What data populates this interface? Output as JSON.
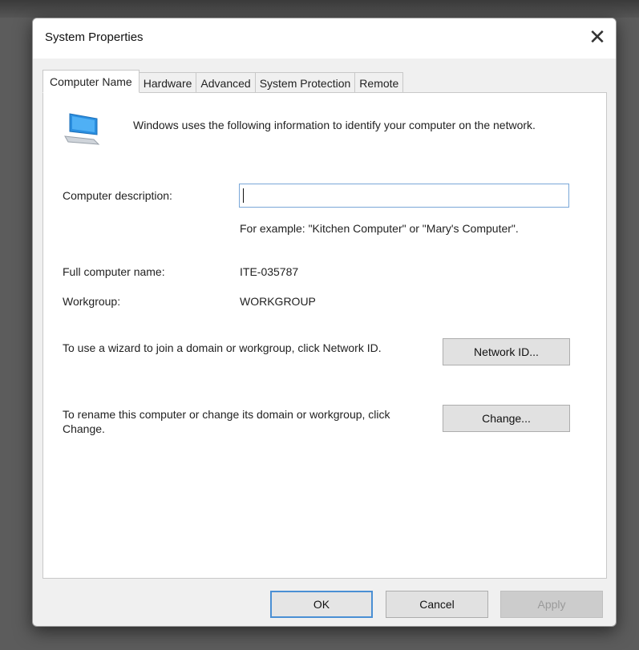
{
  "window": {
    "title": "System Properties",
    "close_glyph": "✕"
  },
  "tabs": [
    {
      "label": "Computer Name",
      "active": true
    },
    {
      "label": "Hardware",
      "active": false
    },
    {
      "label": "Advanced",
      "active": false
    },
    {
      "label": "System Protection",
      "active": false
    },
    {
      "label": "Remote",
      "active": false
    }
  ],
  "panel": {
    "intro": "Windows uses the following information to identify your computer on the network.",
    "description_label": "Computer description:",
    "description_value": "",
    "example": "For example: \"Kitchen Computer\" or \"Mary's Computer\".",
    "full_name_label": "Full computer name:",
    "full_name_value": "ITE-035787",
    "workgroup_label": "Workgroup:",
    "workgroup_value": "WORKGROUP",
    "network_text": "To use a wizard to join a domain or workgroup, click Network ID.",
    "network_button": "Network ID...",
    "rename_text": "To rename this computer or change its domain or workgroup, click Change.",
    "change_button": "Change..."
  },
  "footer": {
    "ok": "OK",
    "cancel": "Cancel",
    "apply": "Apply"
  },
  "colors": {
    "accent": "#4a8fd4",
    "icon_blue": "#2b8fe0"
  }
}
